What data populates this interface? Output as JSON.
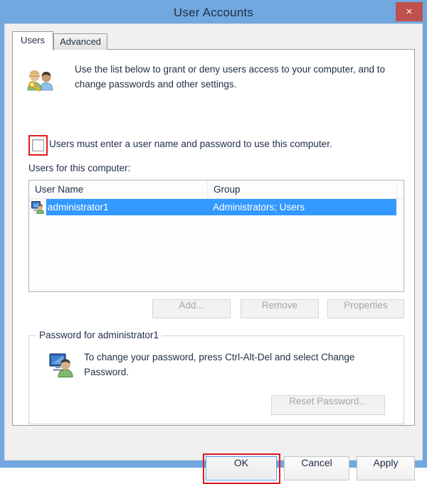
{
  "window": {
    "title": "User Accounts",
    "close_label": "×",
    "close_icon": "close-icon",
    "frame_color": "#71a8e0",
    "close_button_color": "#c0504d"
  },
  "tabs": [
    {
      "label": "Users",
      "active": true
    },
    {
      "label": "Advanced",
      "active": false
    }
  ],
  "header": {
    "icon": "users-key-icon",
    "text": "Use the list below to grant or deny users access to your computer, and to change passwords and other settings."
  },
  "require_login": {
    "checkbox_name": "require-username-password-checkbox",
    "checked": false,
    "label": "Users must enter a user name and password to use this computer.",
    "highlight_color": "#e01b1b"
  },
  "users_list": {
    "caption": "Users for this computer:",
    "columns": [
      "User Name",
      "Group",
      ""
    ],
    "rows": [
      {
        "icon": "user-account-icon",
        "user_name": "administrator1",
        "group": "Administrators; Users",
        "selected": true
      }
    ],
    "selection_color": "#3399ff"
  },
  "list_buttons": [
    {
      "label": "Add...",
      "name": "add-button",
      "disabled": true
    },
    {
      "label": "Remove",
      "name": "remove-button",
      "disabled": true
    },
    {
      "label": "Properties",
      "name": "properties-button",
      "disabled": true
    }
  ],
  "password_group": {
    "title": "Password for administrator1",
    "icon": "user-monitor-icon",
    "text": "To change your password, press Ctrl-Alt-Del and select Change Password.",
    "reset_button": {
      "label": "Reset Password...",
      "disabled": true
    }
  },
  "dialog_buttons": [
    {
      "label": "OK",
      "name": "ok-button",
      "focused": true,
      "highlighted": true
    },
    {
      "label": "Cancel",
      "name": "cancel-button",
      "focused": false,
      "highlighted": false
    },
    {
      "label": "Apply",
      "name": "apply-button",
      "focused": false,
      "highlighted": false
    }
  ]
}
